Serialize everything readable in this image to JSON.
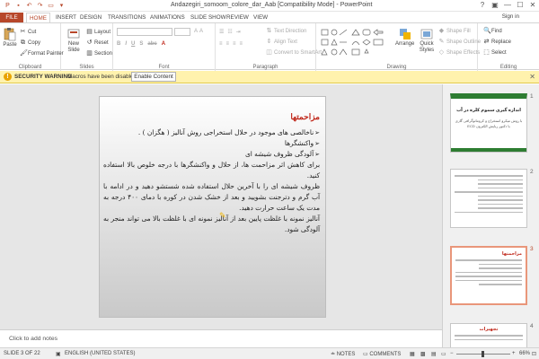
{
  "window": {
    "title": "Andazegiri_somoom_colore_dar_Aab [Compatibility Mode] - PowerPoint",
    "controls": [
      "?",
      "▣",
      "—",
      "☐",
      "✕"
    ]
  },
  "tabs": {
    "file": "FILE",
    "items": [
      "HOME",
      "INSERT",
      "DESIGN",
      "TRANSITIONS",
      "ANIMATIONS",
      "SLIDE SHOW",
      "REVIEW",
      "VIEW"
    ],
    "active": "HOME",
    "signin": "Sign in"
  },
  "ribbon": {
    "clipboard": {
      "paste": "Paste",
      "cut": "Cut",
      "copy": "Copy",
      "format_painter": "Format Painter",
      "label": "Clipboard"
    },
    "slides": {
      "new_slide": "New Slide",
      "layout": "Layout",
      "reset": "Reset",
      "section": "Section",
      "label": "Slides"
    },
    "font": {
      "label": "Font"
    },
    "paragraph": {
      "text_direction": "Text Direction",
      "align_text": "Align Text",
      "convert_smartart": "Convert to SmartArt",
      "label": "Paragraph"
    },
    "drawing": {
      "arrange": "Arrange",
      "quick_styles": "Quick Styles",
      "shape_fill": "Shape Fill",
      "shape_outline": "Shape Outline",
      "shape_effects": "Shape Effects",
      "label": "Drawing"
    },
    "editing": {
      "find": "Find",
      "replace": "Replace",
      "select": "Select",
      "label": "Editing"
    }
  },
  "security": {
    "title": "SECURITY WARNING",
    "message": "Macros have been disabled.",
    "button": "Enable Content"
  },
  "slide": {
    "title": "مزاحمتها",
    "lines": [
      "ناخالصی های موجود در حلال استخراجی روش آنالیز ( هگزان ) .",
      "واکنشگرها",
      "آلودگی ظروف شیشه ای",
      "برای کاهش اثر مزاحمت ها، از حلال و واکنشگرها با درجه خلوص بالا استفاده کنید.",
      "ظروف شیشه ای را با آخرین حلال استفاده شده شستشو دهید و در ادامه با آب گرم و دترجنت بشویید و بعد از خشک شدن در کوره با دمای ۴۰۰ درجه به مدت یک ساعت حرارت دهید.",
      "آنالیز نمونه با غلظت پایین بعد از آنالیز نمونه ای با غلظت بالا می تواند منجر به آلودگی شود."
    ]
  },
  "notes": {
    "placeholder": "Click to add notes"
  },
  "thumbnails": {
    "numbers": [
      "1",
      "2",
      "3",
      "4"
    ],
    "slide1_title": "اندازه گیری سموم کلره در آب",
    "slide1_sub": "با روش میکرو استخراج و کروماتوگرافی گازی با دکتور ربایش الکترون ECD",
    "slide3_title": "مزاحمتها",
    "slide4_title": "تجهیزات"
  },
  "status": {
    "slide": "SLIDE 3 OF 22",
    "language": "ENGLISH (UNITED STATES)",
    "notes": "NOTES",
    "comments": "COMMENTS",
    "zoom": "66%"
  },
  "colors": {
    "accent": "#b7472a",
    "title_red": "#c0281b",
    "warning_bg": "#fff2ad"
  }
}
